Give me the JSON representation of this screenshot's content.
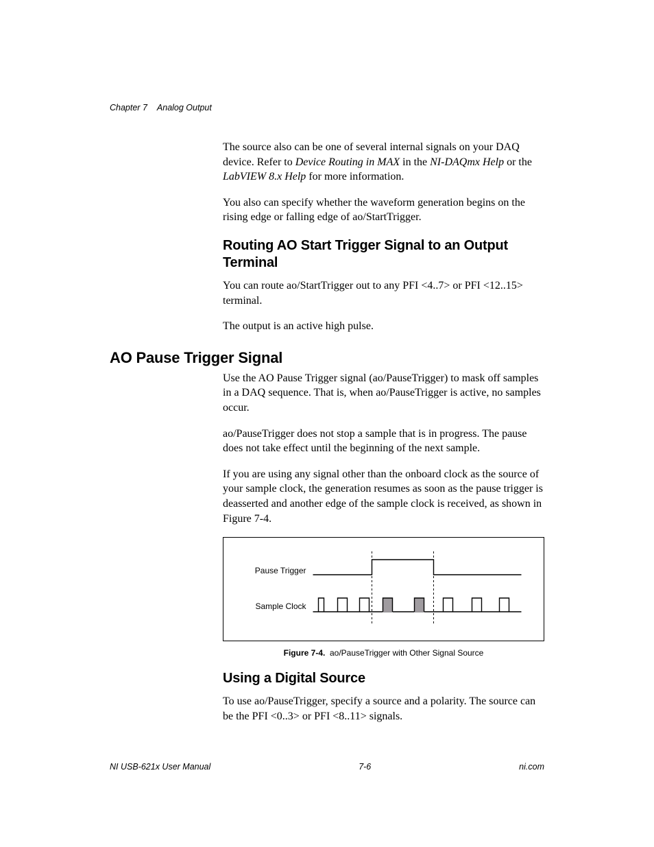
{
  "header": {
    "chapter": "Chapter 7",
    "title": "Analog Output"
  },
  "p1": {
    "pre": "The source also can be one of several internal signals on your DAQ device. Refer to ",
    "em1": "Device Routing in MAX",
    "mid1": " in the ",
    "em2": "NI-DAQmx Help",
    "mid2": " or the ",
    "em3": "LabVIEW 8.x Help",
    "post": " for more information."
  },
  "p2": "You also can specify whether the waveform generation begins on the rising edge or falling edge of ao/StartTrigger.",
  "h_routing": "Routing AO Start Trigger Signal to an Output Terminal",
  "p3": "You can route ao/StartTrigger out to any PFI <4..7> or PFI <12..15> terminal.",
  "p4": "The output is an active high pulse.",
  "h_pause": "AO Pause Trigger Signal",
  "p5": "Use the AO Pause Trigger signal (ao/PauseTrigger) to mask off samples in a DAQ sequence. That is, when ao/PauseTrigger is active, no samples occur.",
  "p6": "ao/PauseTrigger does not stop a sample that is in progress. The pause does not take effect until the beginning of the next sample.",
  "p7": "If you are using any signal other than the onboard clock as the source of your sample clock, the generation resumes as soon as the pause trigger is deasserted and another edge of the sample clock is received, as shown in Figure 7-4.",
  "figure": {
    "label_trigger": "Pause Trigger",
    "label_clock": "Sample Clock",
    "caption_bold": "Figure 7-4.",
    "caption_rest": "ao/PauseTrigger with Other Signal Source"
  },
  "h_digital": "Using a Digital Source",
  "p8": "To use ao/PauseTrigger, specify a source and a polarity. The source can be the PFI <0..3> or PFI <8..11> signals.",
  "footer": {
    "left": "NI USB-621x User Manual",
    "center": "7-6",
    "right": "ni.com"
  }
}
